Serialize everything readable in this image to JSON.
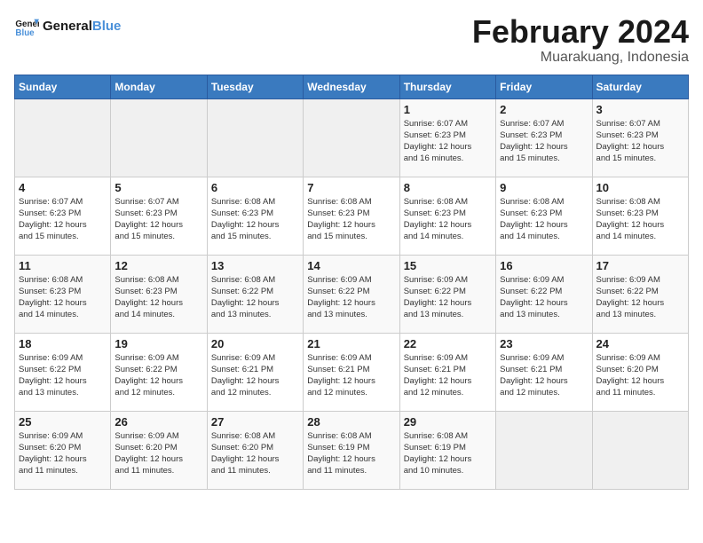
{
  "header": {
    "logo_general": "General",
    "logo_blue": "Blue",
    "month_year": "February 2024",
    "location": "Muarakuang, Indonesia"
  },
  "columns": [
    "Sunday",
    "Monday",
    "Tuesday",
    "Wednesday",
    "Thursday",
    "Friday",
    "Saturday"
  ],
  "weeks": [
    [
      {
        "day": "",
        "info": ""
      },
      {
        "day": "",
        "info": ""
      },
      {
        "day": "",
        "info": ""
      },
      {
        "day": "",
        "info": ""
      },
      {
        "day": "1",
        "info": "Sunrise: 6:07 AM\nSunset: 6:23 PM\nDaylight: 12 hours\nand 16 minutes."
      },
      {
        "day": "2",
        "info": "Sunrise: 6:07 AM\nSunset: 6:23 PM\nDaylight: 12 hours\nand 15 minutes."
      },
      {
        "day": "3",
        "info": "Sunrise: 6:07 AM\nSunset: 6:23 PM\nDaylight: 12 hours\nand 15 minutes."
      }
    ],
    [
      {
        "day": "4",
        "info": "Sunrise: 6:07 AM\nSunset: 6:23 PM\nDaylight: 12 hours\nand 15 minutes."
      },
      {
        "day": "5",
        "info": "Sunrise: 6:07 AM\nSunset: 6:23 PM\nDaylight: 12 hours\nand 15 minutes."
      },
      {
        "day": "6",
        "info": "Sunrise: 6:08 AM\nSunset: 6:23 PM\nDaylight: 12 hours\nand 15 minutes."
      },
      {
        "day": "7",
        "info": "Sunrise: 6:08 AM\nSunset: 6:23 PM\nDaylight: 12 hours\nand 15 minutes."
      },
      {
        "day": "8",
        "info": "Sunrise: 6:08 AM\nSunset: 6:23 PM\nDaylight: 12 hours\nand 14 minutes."
      },
      {
        "day": "9",
        "info": "Sunrise: 6:08 AM\nSunset: 6:23 PM\nDaylight: 12 hours\nand 14 minutes."
      },
      {
        "day": "10",
        "info": "Sunrise: 6:08 AM\nSunset: 6:23 PM\nDaylight: 12 hours\nand 14 minutes."
      }
    ],
    [
      {
        "day": "11",
        "info": "Sunrise: 6:08 AM\nSunset: 6:23 PM\nDaylight: 12 hours\nand 14 minutes."
      },
      {
        "day": "12",
        "info": "Sunrise: 6:08 AM\nSunset: 6:23 PM\nDaylight: 12 hours\nand 14 minutes."
      },
      {
        "day": "13",
        "info": "Sunrise: 6:08 AM\nSunset: 6:22 PM\nDaylight: 12 hours\nand 13 minutes."
      },
      {
        "day": "14",
        "info": "Sunrise: 6:09 AM\nSunset: 6:22 PM\nDaylight: 12 hours\nand 13 minutes."
      },
      {
        "day": "15",
        "info": "Sunrise: 6:09 AM\nSunset: 6:22 PM\nDaylight: 12 hours\nand 13 minutes."
      },
      {
        "day": "16",
        "info": "Sunrise: 6:09 AM\nSunset: 6:22 PM\nDaylight: 12 hours\nand 13 minutes."
      },
      {
        "day": "17",
        "info": "Sunrise: 6:09 AM\nSunset: 6:22 PM\nDaylight: 12 hours\nand 13 minutes."
      }
    ],
    [
      {
        "day": "18",
        "info": "Sunrise: 6:09 AM\nSunset: 6:22 PM\nDaylight: 12 hours\nand 13 minutes."
      },
      {
        "day": "19",
        "info": "Sunrise: 6:09 AM\nSunset: 6:22 PM\nDaylight: 12 hours\nand 12 minutes."
      },
      {
        "day": "20",
        "info": "Sunrise: 6:09 AM\nSunset: 6:21 PM\nDaylight: 12 hours\nand 12 minutes."
      },
      {
        "day": "21",
        "info": "Sunrise: 6:09 AM\nSunset: 6:21 PM\nDaylight: 12 hours\nand 12 minutes."
      },
      {
        "day": "22",
        "info": "Sunrise: 6:09 AM\nSunset: 6:21 PM\nDaylight: 12 hours\nand 12 minutes."
      },
      {
        "day": "23",
        "info": "Sunrise: 6:09 AM\nSunset: 6:21 PM\nDaylight: 12 hours\nand 12 minutes."
      },
      {
        "day": "24",
        "info": "Sunrise: 6:09 AM\nSunset: 6:20 PM\nDaylight: 12 hours\nand 11 minutes."
      }
    ],
    [
      {
        "day": "25",
        "info": "Sunrise: 6:09 AM\nSunset: 6:20 PM\nDaylight: 12 hours\nand 11 minutes."
      },
      {
        "day": "26",
        "info": "Sunrise: 6:09 AM\nSunset: 6:20 PM\nDaylight: 12 hours\nand 11 minutes."
      },
      {
        "day": "27",
        "info": "Sunrise: 6:08 AM\nSunset: 6:20 PM\nDaylight: 12 hours\nand 11 minutes."
      },
      {
        "day": "28",
        "info": "Sunrise: 6:08 AM\nSunset: 6:19 PM\nDaylight: 12 hours\nand 11 minutes."
      },
      {
        "day": "29",
        "info": "Sunrise: 6:08 AM\nSunset: 6:19 PM\nDaylight: 12 hours\nand 10 minutes."
      },
      {
        "day": "",
        "info": ""
      },
      {
        "day": "",
        "info": ""
      }
    ]
  ]
}
